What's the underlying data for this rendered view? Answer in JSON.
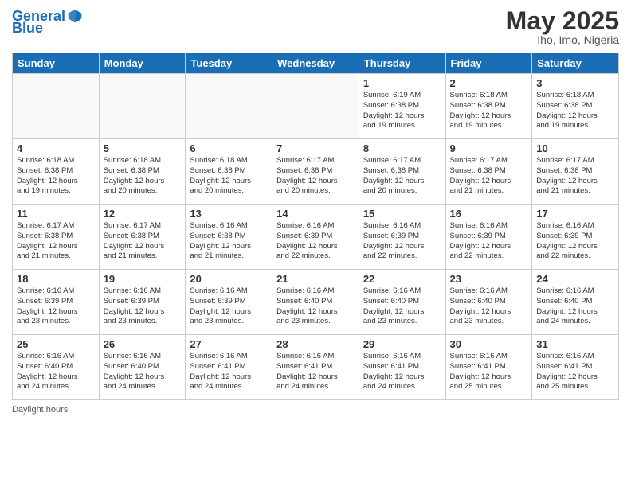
{
  "logo": {
    "text1": "General",
    "text2": "Blue"
  },
  "title": "May 2025",
  "location": "Iho, Imo, Nigeria",
  "days_of_week": [
    "Sunday",
    "Monday",
    "Tuesday",
    "Wednesday",
    "Thursday",
    "Friday",
    "Saturday"
  ],
  "footer_label": "Daylight hours",
  "weeks": [
    [
      {
        "day": "",
        "info": ""
      },
      {
        "day": "",
        "info": ""
      },
      {
        "day": "",
        "info": ""
      },
      {
        "day": "",
        "info": ""
      },
      {
        "day": "1",
        "info": "Sunrise: 6:19 AM\nSunset: 6:38 PM\nDaylight: 12 hours\nand 19 minutes."
      },
      {
        "day": "2",
        "info": "Sunrise: 6:18 AM\nSunset: 6:38 PM\nDaylight: 12 hours\nand 19 minutes."
      },
      {
        "day": "3",
        "info": "Sunrise: 6:18 AM\nSunset: 6:38 PM\nDaylight: 12 hours\nand 19 minutes."
      }
    ],
    [
      {
        "day": "4",
        "info": "Sunrise: 6:18 AM\nSunset: 6:38 PM\nDaylight: 12 hours\nand 19 minutes."
      },
      {
        "day": "5",
        "info": "Sunrise: 6:18 AM\nSunset: 6:38 PM\nDaylight: 12 hours\nand 20 minutes."
      },
      {
        "day": "6",
        "info": "Sunrise: 6:18 AM\nSunset: 6:38 PM\nDaylight: 12 hours\nand 20 minutes."
      },
      {
        "day": "7",
        "info": "Sunrise: 6:17 AM\nSunset: 6:38 PM\nDaylight: 12 hours\nand 20 minutes."
      },
      {
        "day": "8",
        "info": "Sunrise: 6:17 AM\nSunset: 6:38 PM\nDaylight: 12 hours\nand 20 minutes."
      },
      {
        "day": "9",
        "info": "Sunrise: 6:17 AM\nSunset: 6:38 PM\nDaylight: 12 hours\nand 21 minutes."
      },
      {
        "day": "10",
        "info": "Sunrise: 6:17 AM\nSunset: 6:38 PM\nDaylight: 12 hours\nand 21 minutes."
      }
    ],
    [
      {
        "day": "11",
        "info": "Sunrise: 6:17 AM\nSunset: 6:38 PM\nDaylight: 12 hours\nand 21 minutes."
      },
      {
        "day": "12",
        "info": "Sunrise: 6:17 AM\nSunset: 6:38 PM\nDaylight: 12 hours\nand 21 minutes."
      },
      {
        "day": "13",
        "info": "Sunrise: 6:16 AM\nSunset: 6:38 PM\nDaylight: 12 hours\nand 21 minutes."
      },
      {
        "day": "14",
        "info": "Sunrise: 6:16 AM\nSunset: 6:39 PM\nDaylight: 12 hours\nand 22 minutes."
      },
      {
        "day": "15",
        "info": "Sunrise: 6:16 AM\nSunset: 6:39 PM\nDaylight: 12 hours\nand 22 minutes."
      },
      {
        "day": "16",
        "info": "Sunrise: 6:16 AM\nSunset: 6:39 PM\nDaylight: 12 hours\nand 22 minutes."
      },
      {
        "day": "17",
        "info": "Sunrise: 6:16 AM\nSunset: 6:39 PM\nDaylight: 12 hours\nand 22 minutes."
      }
    ],
    [
      {
        "day": "18",
        "info": "Sunrise: 6:16 AM\nSunset: 6:39 PM\nDaylight: 12 hours\nand 23 minutes."
      },
      {
        "day": "19",
        "info": "Sunrise: 6:16 AM\nSunset: 6:39 PM\nDaylight: 12 hours\nand 23 minutes."
      },
      {
        "day": "20",
        "info": "Sunrise: 6:16 AM\nSunset: 6:39 PM\nDaylight: 12 hours\nand 23 minutes."
      },
      {
        "day": "21",
        "info": "Sunrise: 6:16 AM\nSunset: 6:40 PM\nDaylight: 12 hours\nand 23 minutes."
      },
      {
        "day": "22",
        "info": "Sunrise: 6:16 AM\nSunset: 6:40 PM\nDaylight: 12 hours\nand 23 minutes."
      },
      {
        "day": "23",
        "info": "Sunrise: 6:16 AM\nSunset: 6:40 PM\nDaylight: 12 hours\nand 23 minutes."
      },
      {
        "day": "24",
        "info": "Sunrise: 6:16 AM\nSunset: 6:40 PM\nDaylight: 12 hours\nand 24 minutes."
      }
    ],
    [
      {
        "day": "25",
        "info": "Sunrise: 6:16 AM\nSunset: 6:40 PM\nDaylight: 12 hours\nand 24 minutes."
      },
      {
        "day": "26",
        "info": "Sunrise: 6:16 AM\nSunset: 6:40 PM\nDaylight: 12 hours\nand 24 minutes."
      },
      {
        "day": "27",
        "info": "Sunrise: 6:16 AM\nSunset: 6:41 PM\nDaylight: 12 hours\nand 24 minutes."
      },
      {
        "day": "28",
        "info": "Sunrise: 6:16 AM\nSunset: 6:41 PM\nDaylight: 12 hours\nand 24 minutes."
      },
      {
        "day": "29",
        "info": "Sunrise: 6:16 AM\nSunset: 6:41 PM\nDaylight: 12 hours\nand 24 minutes."
      },
      {
        "day": "30",
        "info": "Sunrise: 6:16 AM\nSunset: 6:41 PM\nDaylight: 12 hours\nand 25 minutes."
      },
      {
        "day": "31",
        "info": "Sunrise: 6:16 AM\nSunset: 6:41 PM\nDaylight: 12 hours\nand 25 minutes."
      }
    ]
  ]
}
